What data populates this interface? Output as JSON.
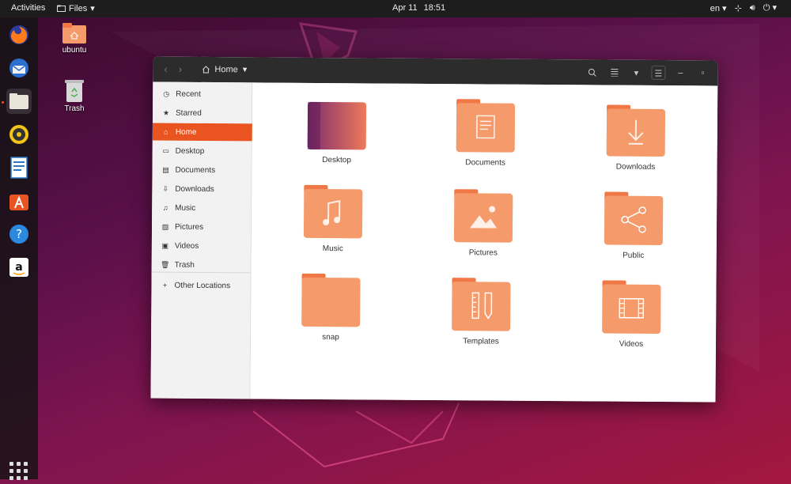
{
  "topbar": {
    "activities": "Activities",
    "app_menu": "Files",
    "date": "Apr 11",
    "time": "18:51",
    "lang": "en"
  },
  "desktop": {
    "icons": [
      {
        "label": "ubuntu"
      },
      {
        "label": "Trash"
      }
    ]
  },
  "dock": {
    "items": [
      {
        "icon": "firefox-icon"
      },
      {
        "icon": "thunderbird-icon"
      },
      {
        "icon": "files-icon"
      },
      {
        "icon": "rhythmbox-icon"
      },
      {
        "icon": "libreoffice-writer-icon"
      },
      {
        "icon": "ubuntu-software-icon"
      },
      {
        "icon": "help-icon"
      },
      {
        "icon": "amazon-icon"
      }
    ]
  },
  "window": {
    "path_label": "Home",
    "sidebar": {
      "items": [
        {
          "label": "Recent",
          "icon": "clock-icon"
        },
        {
          "label": "Starred",
          "icon": "star-icon"
        },
        {
          "label": "Home",
          "icon": "home-icon",
          "active": true
        },
        {
          "label": "Desktop",
          "icon": "desktop-icon"
        },
        {
          "label": "Documents",
          "icon": "document-icon"
        },
        {
          "label": "Downloads",
          "icon": "download-icon"
        },
        {
          "label": "Music",
          "icon": "music-icon"
        },
        {
          "label": "Pictures",
          "icon": "picture-icon"
        },
        {
          "label": "Videos",
          "icon": "video-icon"
        },
        {
          "label": "Trash",
          "icon": "trash-icon"
        }
      ],
      "other_locations": "Other Locations"
    },
    "folders": [
      {
        "label": "Desktop"
      },
      {
        "label": "Documents"
      },
      {
        "label": "Downloads"
      },
      {
        "label": "Music"
      },
      {
        "label": "Pictures"
      },
      {
        "label": "Public"
      },
      {
        "label": "snap"
      },
      {
        "label": "Templates"
      },
      {
        "label": "Videos"
      }
    ]
  },
  "colors": {
    "accent": "#e95420",
    "folder_top": "#f07746",
    "folder_body": "#f59a6a"
  }
}
